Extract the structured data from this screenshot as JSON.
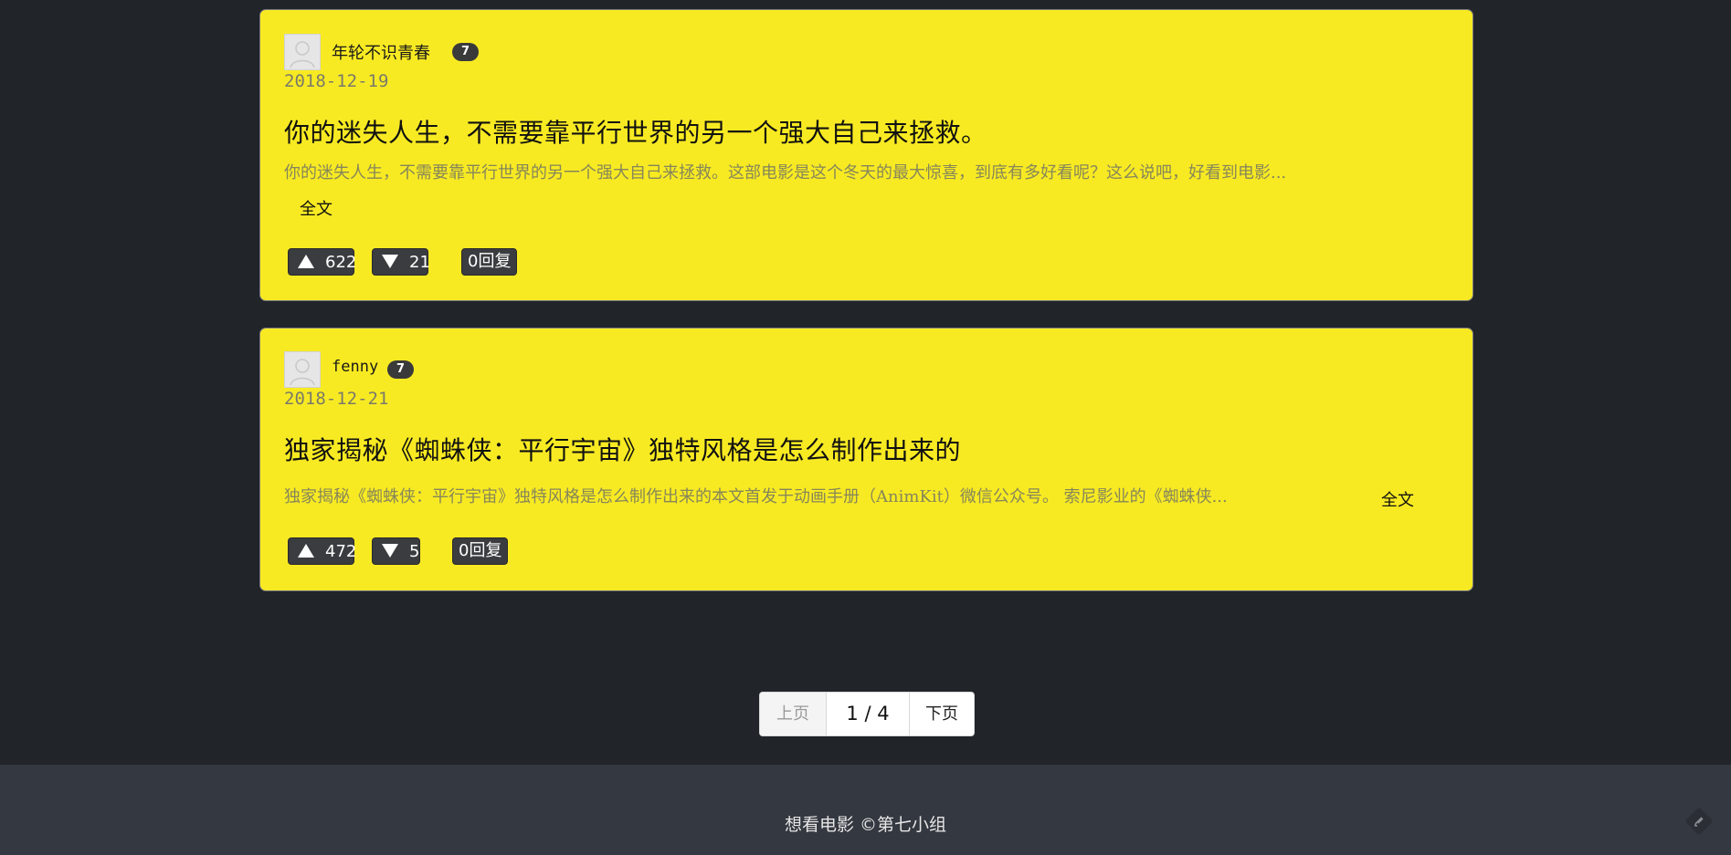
{
  "reviews": [
    {
      "username": "年轮不识青春",
      "level": "7",
      "date": "2018-12-19",
      "title": "你的迷失人生，不需要靠平行世界的另一个强大自己来拯救。",
      "excerpt": "你的迷失人生，不需要靠平行世界的另一个强大自己来拯救。这部电影是这个冬天的最大惊喜，到底有多好看呢？这么说吧，好看到电影...",
      "fulltext_label": "全文",
      "upvotes": "622",
      "downvotes": "21",
      "replies": "0回复"
    },
    {
      "username": "fenny",
      "level": "7",
      "date": "2018-12-21",
      "title": "独家揭秘《蜘蛛侠：平行宇宙》独特风格是怎么制作出来的",
      "excerpt": "独家揭秘《蜘蛛侠：平行宇宙》独特风格是怎么制作出来的本文首发于动画手册（AnimKit）微信公众号。 索尼影业的《蜘蛛侠...",
      "fulltext_label": "全文",
      "upvotes": "472",
      "downvotes": "5",
      "replies": "0回复"
    }
  ],
  "pagination": {
    "prev_label": "上页",
    "indicator": "1 / 4",
    "next_label": "下页"
  },
  "footer": {
    "text": "想看电影 ©第七小组"
  },
  "colors": {
    "background": "#212429",
    "card": "#f8ea22",
    "footer": "#343840",
    "button": "#3b3c3f"
  }
}
